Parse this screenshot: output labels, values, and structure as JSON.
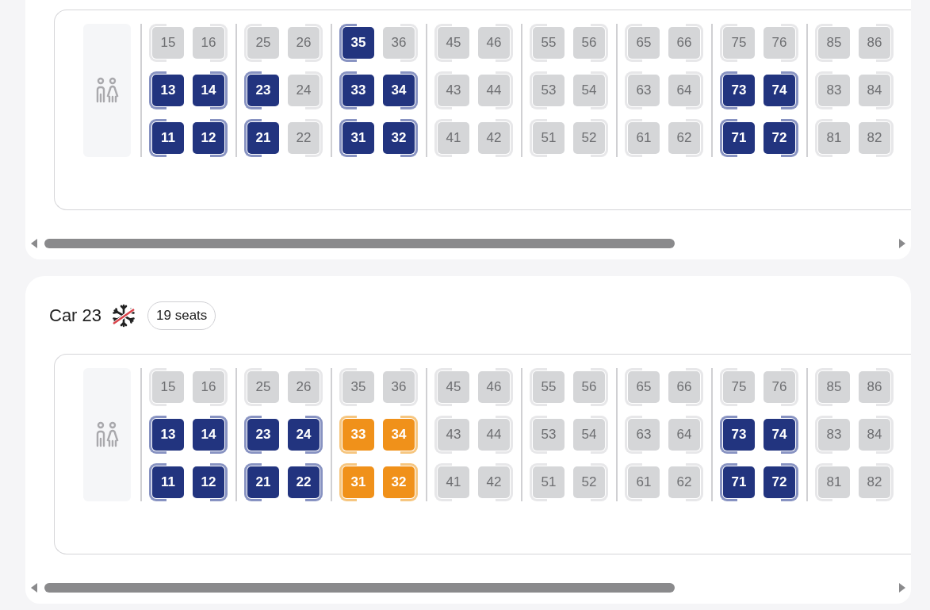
{
  "cars": [
    {
      "compartments": [
        {
          "seats": [
            {
              "number": "15",
              "available": false,
              "selected": false
            },
            {
              "number": "16",
              "available": false,
              "selected": false
            },
            {
              "number": "13",
              "available": true,
              "selected": false
            },
            {
              "number": "14",
              "available": true,
              "selected": false
            },
            {
              "number": "11",
              "available": true,
              "selected": false
            },
            {
              "number": "12",
              "available": true,
              "selected": false
            }
          ]
        },
        {
          "seats": [
            {
              "number": "25",
              "available": false,
              "selected": false
            },
            {
              "number": "26",
              "available": false,
              "selected": false
            },
            {
              "number": "23",
              "available": true,
              "selected": false
            },
            {
              "number": "24",
              "available": false,
              "selected": false
            },
            {
              "number": "21",
              "available": true,
              "selected": false
            },
            {
              "number": "22",
              "available": false,
              "selected": false
            }
          ]
        },
        {
          "seats": [
            {
              "number": "35",
              "available": true,
              "selected": false
            },
            {
              "number": "36",
              "available": false,
              "selected": false
            },
            {
              "number": "33",
              "available": true,
              "selected": false
            },
            {
              "number": "34",
              "available": true,
              "selected": false
            },
            {
              "number": "31",
              "available": true,
              "selected": false
            },
            {
              "number": "32",
              "available": true,
              "selected": false
            }
          ]
        },
        {
          "seats": [
            {
              "number": "45",
              "available": false,
              "selected": false
            },
            {
              "number": "46",
              "available": false,
              "selected": false
            },
            {
              "number": "43",
              "available": false,
              "selected": false
            },
            {
              "number": "44",
              "available": false,
              "selected": false
            },
            {
              "number": "41",
              "available": false,
              "selected": false
            },
            {
              "number": "42",
              "available": false,
              "selected": false
            }
          ]
        },
        {
          "seats": [
            {
              "number": "55",
              "available": false,
              "selected": false
            },
            {
              "number": "56",
              "available": false,
              "selected": false
            },
            {
              "number": "53",
              "available": false,
              "selected": false
            },
            {
              "number": "54",
              "available": false,
              "selected": false
            },
            {
              "number": "51",
              "available": false,
              "selected": false
            },
            {
              "number": "52",
              "available": false,
              "selected": false
            }
          ]
        },
        {
          "seats": [
            {
              "number": "65",
              "available": false,
              "selected": false
            },
            {
              "number": "66",
              "available": false,
              "selected": false
            },
            {
              "number": "63",
              "available": false,
              "selected": false
            },
            {
              "number": "64",
              "available": false,
              "selected": false
            },
            {
              "number": "61",
              "available": false,
              "selected": false
            },
            {
              "number": "62",
              "available": false,
              "selected": false
            }
          ]
        },
        {
          "seats": [
            {
              "number": "75",
              "available": false,
              "selected": false
            },
            {
              "number": "76",
              "available": false,
              "selected": false
            },
            {
              "number": "73",
              "available": true,
              "selected": false
            },
            {
              "number": "74",
              "available": true,
              "selected": false
            },
            {
              "number": "71",
              "available": true,
              "selected": false
            },
            {
              "number": "72",
              "available": true,
              "selected": false
            }
          ]
        },
        {
          "seats": [
            {
              "number": "85",
              "available": false,
              "selected": false
            },
            {
              "number": "86",
              "available": false,
              "selected": false
            },
            {
              "number": "83",
              "available": false,
              "selected": false
            },
            {
              "number": "84",
              "available": false,
              "selected": false
            },
            {
              "number": "81",
              "available": false,
              "selected": false
            },
            {
              "number": "82",
              "available": false,
              "selected": false
            }
          ]
        }
      ]
    },
    {
      "title": "Car 23",
      "seat_count": "19 seats",
      "compartments": [
        {
          "seats": [
            {
              "number": "15",
              "available": false,
              "selected": false
            },
            {
              "number": "16",
              "available": false,
              "selected": false
            },
            {
              "number": "13",
              "available": true,
              "selected": false
            },
            {
              "number": "14",
              "available": true,
              "selected": false
            },
            {
              "number": "11",
              "available": true,
              "selected": false
            },
            {
              "number": "12",
              "available": true,
              "selected": false
            }
          ]
        },
        {
          "seats": [
            {
              "number": "25",
              "available": false,
              "selected": false
            },
            {
              "number": "26",
              "available": false,
              "selected": false
            },
            {
              "number": "23",
              "available": true,
              "selected": false
            },
            {
              "number": "24",
              "available": true,
              "selected": false
            },
            {
              "number": "21",
              "available": true,
              "selected": false
            },
            {
              "number": "22",
              "available": true,
              "selected": false
            }
          ]
        },
        {
          "seats": [
            {
              "number": "35",
              "available": false,
              "selected": false
            },
            {
              "number": "36",
              "available": false,
              "selected": false
            },
            {
              "number": "33",
              "available": true,
              "selected": true
            },
            {
              "number": "34",
              "available": true,
              "selected": true
            },
            {
              "number": "31",
              "available": true,
              "selected": true
            },
            {
              "number": "32",
              "available": true,
              "selected": true
            }
          ]
        },
        {
          "seats": [
            {
              "number": "45",
              "available": false,
              "selected": false
            },
            {
              "number": "46",
              "available": false,
              "selected": false
            },
            {
              "number": "43",
              "available": false,
              "selected": false
            },
            {
              "number": "44",
              "available": false,
              "selected": false
            },
            {
              "number": "41",
              "available": false,
              "selected": false
            },
            {
              "number": "42",
              "available": false,
              "selected": false
            }
          ]
        },
        {
          "seats": [
            {
              "number": "55",
              "available": false,
              "selected": false
            },
            {
              "number": "56",
              "available": false,
              "selected": false
            },
            {
              "number": "53",
              "available": false,
              "selected": false
            },
            {
              "number": "54",
              "available": false,
              "selected": false
            },
            {
              "number": "51",
              "available": false,
              "selected": false
            },
            {
              "number": "52",
              "available": false,
              "selected": false
            }
          ]
        },
        {
          "seats": [
            {
              "number": "65",
              "available": false,
              "selected": false
            },
            {
              "number": "66",
              "available": false,
              "selected": false
            },
            {
              "number": "63",
              "available": false,
              "selected": false
            },
            {
              "number": "64",
              "available": false,
              "selected": false
            },
            {
              "number": "61",
              "available": false,
              "selected": false
            },
            {
              "number": "62",
              "available": false,
              "selected": false
            }
          ]
        },
        {
          "seats": [
            {
              "number": "75",
              "available": false,
              "selected": false
            },
            {
              "number": "76",
              "available": false,
              "selected": false
            },
            {
              "number": "73",
              "available": true,
              "selected": false
            },
            {
              "number": "74",
              "available": true,
              "selected": false
            },
            {
              "number": "71",
              "available": true,
              "selected": false
            },
            {
              "number": "72",
              "available": true,
              "selected": false
            }
          ]
        },
        {
          "seats": [
            {
              "number": "85",
              "available": false,
              "selected": false
            },
            {
              "number": "86",
              "available": false,
              "selected": false
            },
            {
              "number": "83",
              "available": false,
              "selected": false
            },
            {
              "number": "84",
              "available": false,
              "selected": false
            },
            {
              "number": "81",
              "available": false,
              "selected": false
            },
            {
              "number": "82",
              "available": false,
              "selected": false
            }
          ]
        }
      ]
    }
  ]
}
